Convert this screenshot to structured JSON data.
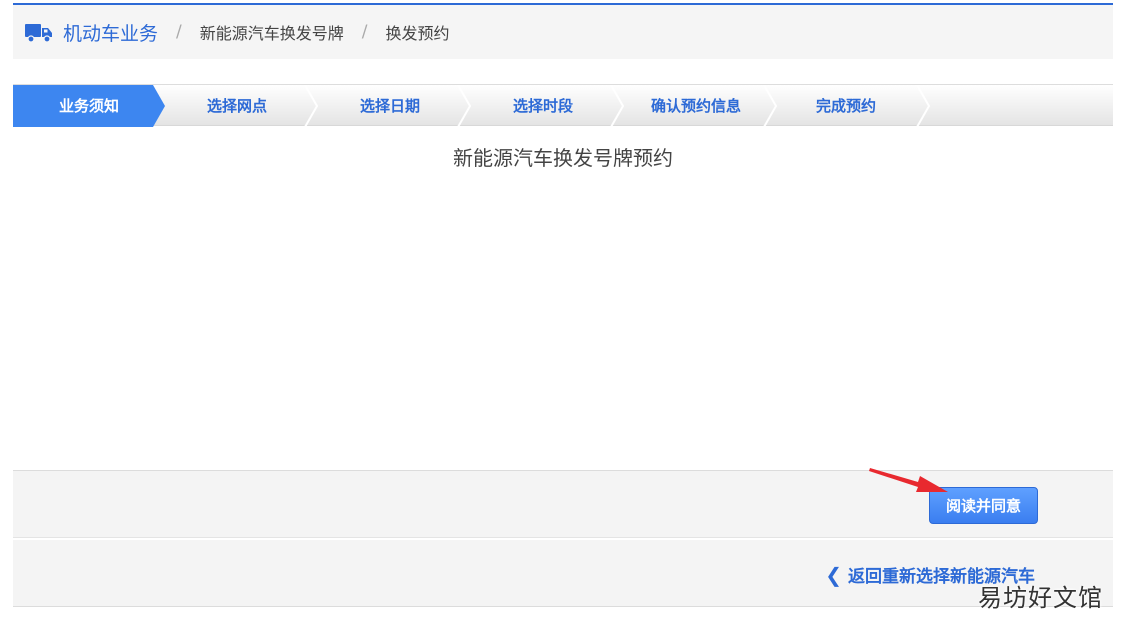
{
  "breadcrumb": {
    "home_icon": "truck-icon",
    "home": "机动车业务",
    "items": [
      "新能源汽车换发号牌",
      "换发预约"
    ],
    "separator": "/"
  },
  "steps": [
    {
      "label": "业务须知",
      "active": true
    },
    {
      "label": "选择网点",
      "active": false
    },
    {
      "label": "选择日期",
      "active": false
    },
    {
      "label": "选择时段",
      "active": false
    },
    {
      "label": "确认预约信息",
      "active": false
    },
    {
      "label": "完成预约",
      "active": false
    }
  ],
  "content": {
    "title": "新能源汽车换发号牌预约"
  },
  "actions": {
    "agree_label": "阅读并同意"
  },
  "footer": {
    "back_icon": "chevron-left-icon",
    "back_label": "返回重新选择新能源汽车"
  },
  "watermark": "易坊好文馆",
  "colors": {
    "accent": "#2d6ad6",
    "active_step": "#3d86f0",
    "annotation_arrow": "#e8292f"
  }
}
